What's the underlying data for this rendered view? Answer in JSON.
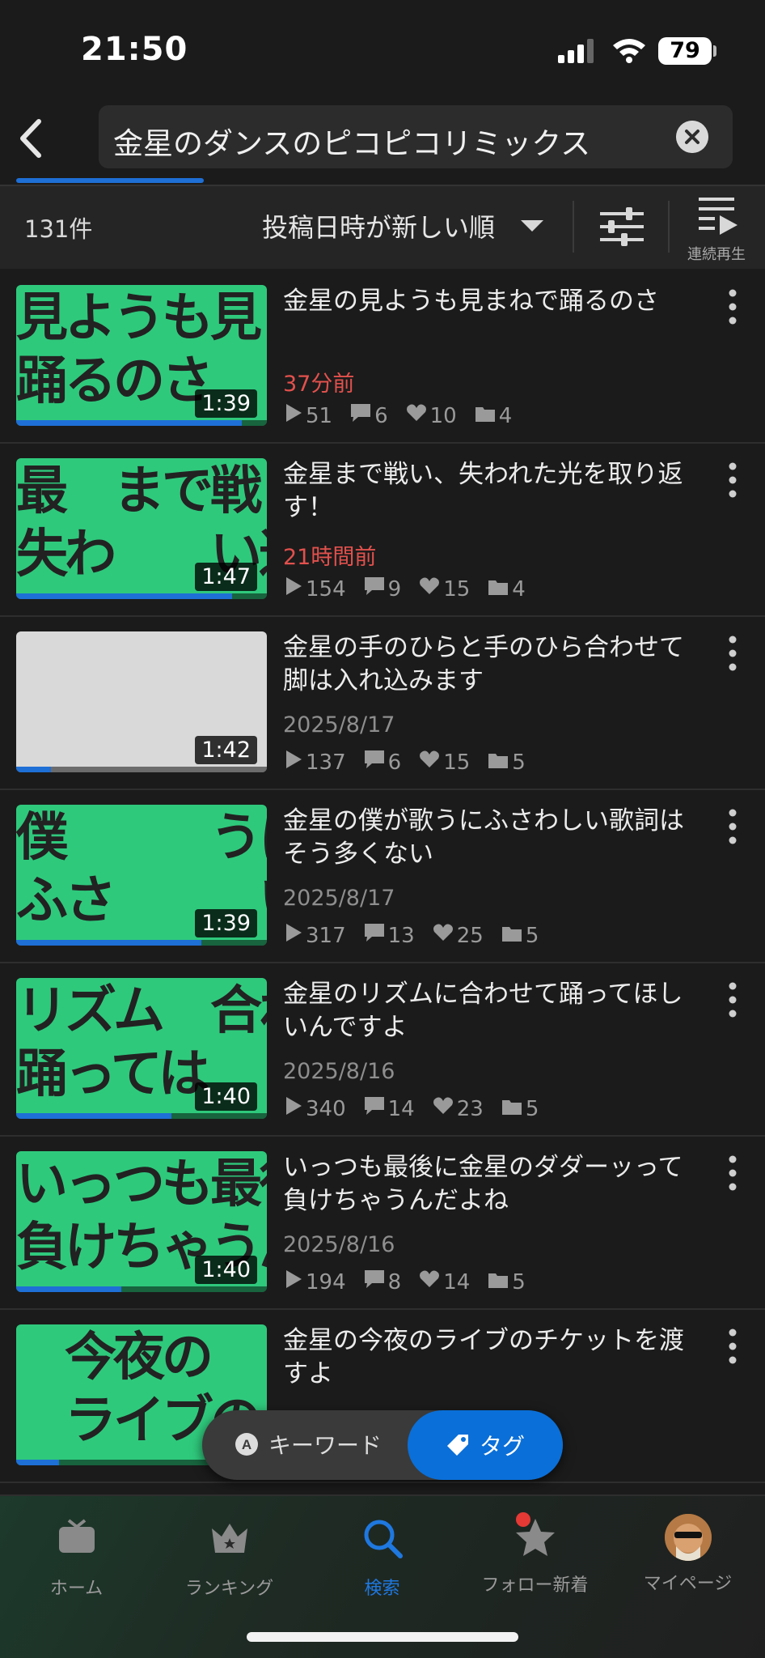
{
  "status_bar": {
    "time": "21:50",
    "battery": "79"
  },
  "search": {
    "query": "金星のダンスのピコピコリミックス"
  },
  "filter_bar": {
    "count": "131件",
    "sort_label": "投稿日時が新しい順",
    "continuous_play_label": "連続再生"
  },
  "videos": [
    {
      "title": "金星の見ようも見まねで踊るのさ",
      "date": "37分前",
      "recent": true,
      "duration": "1:39",
      "views": "51",
      "comments": "6",
      "likes": "10",
      "mylists": "4",
      "thumb_text": [
        "見ようも見まねで",
        "踊るのさ"
      ],
      "thumb_color": "#2fc97c",
      "progress": 0.9
    },
    {
      "title": "金星まで戦い、失われた光を取り返す！",
      "date": "21時間前",
      "recent": true,
      "duration": "1:47",
      "views": "154",
      "comments": "9",
      "likes": "15",
      "mylists": "4",
      "thumb_text": [
        "最　まで戦し",
        "失わ　　い返す"
      ],
      "thumb_color": "#2fc97c",
      "progress": 0.86
    },
    {
      "title": "金星の手のひらと手のひら合わせて脚は入れ込みます",
      "date": "2025/8/17",
      "recent": false,
      "duration": "1:42",
      "views": "137",
      "comments": "6",
      "likes": "15",
      "mylists": "5",
      "thumb_text": [
        "",
        ""
      ],
      "thumb_color": "#d9d9d9",
      "progress": 0.14
    },
    {
      "title": "金星の僕が歌うにふさわしい歌詞はそう多くない",
      "date": "2025/8/17",
      "recent": false,
      "duration": "1:39",
      "views": "317",
      "comments": "13",
      "likes": "25",
      "mylists": "5",
      "thumb_text": [
        "僕　　　うに",
        "ふさ　　　い"
      ],
      "thumb_color": "#2fc97c",
      "progress": 0.74
    },
    {
      "title": "金星のリズムに合わせて踊ってほしいんですよ",
      "date": "2025/8/16",
      "recent": false,
      "duration": "1:40",
      "views": "340",
      "comments": "14",
      "likes": "23",
      "mylists": "5",
      "thumb_text": [
        "リズム　合わせて",
        "踊っては"
      ],
      "thumb_color": "#2fc97c",
      "progress": 0.62
    },
    {
      "title": "いっつも最後に金星のダダーッって負けちゃうんだよね",
      "date": "2025/8/16",
      "recent": false,
      "duration": "1:40",
      "views": "194",
      "comments": "8",
      "likes": "14",
      "mylists": "5",
      "thumb_text": [
        "いっつも最後に",
        "負けちゃうんだよね"
      ],
      "thumb_color": "#2fc97c",
      "progress": 0.42
    },
    {
      "title": "金星の今夜のライブのチケットを渡すよ",
      "date": "",
      "recent": false,
      "duration": "",
      "views": "",
      "comments": "",
      "likes": "",
      "mylists": "",
      "thumb_text": [
        "　今夜の",
        "　ライブの"
      ],
      "thumb_color": "#2fc97c",
      "progress": 0.17
    }
  ],
  "toggle": {
    "keyword_label": "キーワード",
    "tag_label": "タグ"
  },
  "bottom_nav": [
    {
      "label": "ホーム",
      "icon": "tv-icon",
      "active": false
    },
    {
      "label": "ランキング",
      "icon": "crown-icon",
      "active": false
    },
    {
      "label": "検索",
      "icon": "search-icon",
      "active": true
    },
    {
      "label": "フォロー新着",
      "icon": "star-icon",
      "active": false,
      "badge": true
    },
    {
      "label": "マイページ",
      "icon": "avatar-icon",
      "active": false
    }
  ],
  "colors": {
    "accent": "#1e6fd6",
    "recent_date": "#e2514d",
    "thumb_green": "#2fc97c"
  }
}
